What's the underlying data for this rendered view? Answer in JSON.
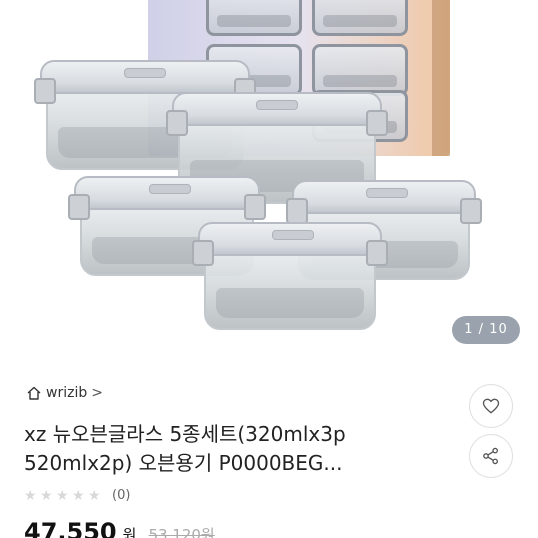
{
  "image": {
    "pager_current": "1",
    "pager_separator": "/",
    "pager_total": "10"
  },
  "store": {
    "icon": "home-icon",
    "name": "wrizib",
    "chevron": ">"
  },
  "product": {
    "title_line1": "xz 뉴오븐글라스 5종세트(320mlx3p",
    "title_line2": "520mlx2p) 오븐용기 P0000BEG...",
    "rating_stars": 0,
    "rating_max": 5,
    "review_count": "(0)",
    "price": "47,550",
    "currency": "원",
    "original_price": "53,120원"
  },
  "actions": {
    "like_icon": "heart-icon",
    "share_icon": "share-icon"
  }
}
